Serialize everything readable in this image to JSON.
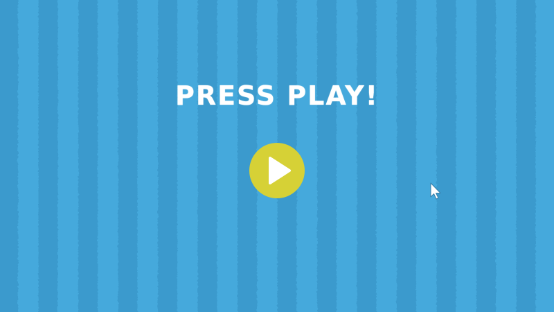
{
  "screen": {
    "title": "PRESS PLAY!",
    "background_color": "#45a9dc",
    "stripe_color": "#3b9acd"
  },
  "play_button": {
    "icon": "play-icon",
    "color": "#d6d136",
    "icon_color": "#ffffff"
  },
  "pointer": {
    "icon": "mouse-cursor-icon"
  }
}
